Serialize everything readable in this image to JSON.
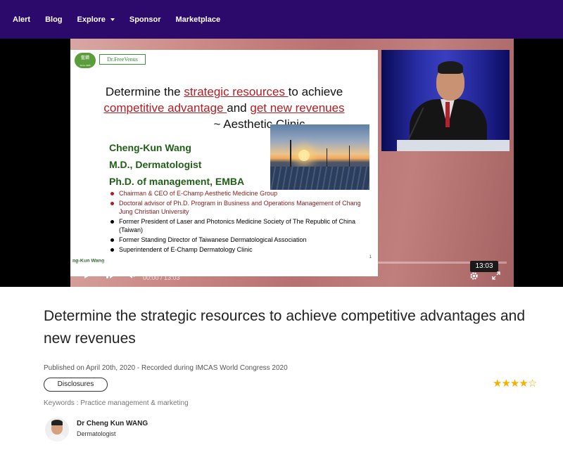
{
  "nav": {
    "items": [
      "Alert",
      "Blog",
      "Explore",
      "Sponsor",
      "Marketplace"
    ]
  },
  "video": {
    "slide": {
      "logo_text": "藍鑽",
      "logo_small": "Since 1985",
      "brand": "Dr.FreeVenus",
      "title_prefix": "Determine the ",
      "title_red1": "strategic resources ",
      "title_mid": "to achieve",
      "title_red2": "competitive advantage ",
      "title_and": "and ",
      "title_red3": "get new revenues",
      "title_sub": "~ Aesthetic Clinic",
      "name": "Cheng-Kun Wang",
      "degree1": "M.D., Dermatologist",
      "degree2": "Ph.D. of management, EMBA",
      "bullets": [
        "Chairman & CEO of E-Champ Aesthetic Medicine Group",
        "Doctoral advisor of Ph.D. Program in Business and Operations Management of Chang Jung Christian University",
        "Former President of Laser and Photonics Medicine Society of The Republic of China (Taiwan)",
        "Former Standing Director of Taiwanese Dermatological Association",
        "Superintendent of E-Champ Dermatology Clinic"
      ],
      "page_number": "1",
      "watermark": "ng-Kun Wang"
    },
    "duration": "13:03",
    "current_time": "00:00 / 13:03"
  },
  "content": {
    "title": "Determine the strategic resources to achieve competitive advantages and new revenues",
    "published": "Published on April 20th, 2020 - Recorded during IMCAS World Congress 2020",
    "disclosures_label": "Disclosures",
    "rating": 4,
    "rating_max": 5,
    "keywords": "Keywords : Practice management & marketing",
    "author": {
      "name": "Dr Cheng Kun WANG",
      "role": "Dermatologist"
    }
  },
  "colors": {
    "nav_bg": "#2b0a6b",
    "star": "#f5b000",
    "slide_red": "#b01e24",
    "slide_green": "#1f5f16"
  }
}
